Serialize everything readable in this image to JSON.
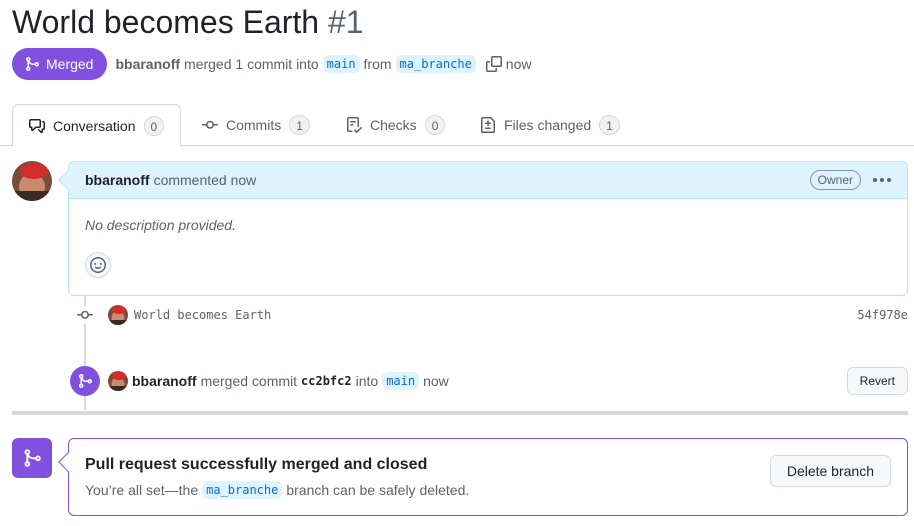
{
  "pr": {
    "title": "World becomes Earth",
    "number": "#1",
    "state_label": "Merged",
    "author": "bbaranoff",
    "merge_text": "merged 1 commit into",
    "base_branch": "main",
    "from_text": "from",
    "head_branch": "ma_branche",
    "time": "now"
  },
  "tabs": [
    {
      "label": "Conversation",
      "count": "0",
      "icon": "comment-discussion-icon"
    },
    {
      "label": "Commits",
      "count": "1",
      "icon": "git-commit-icon"
    },
    {
      "label": "Checks",
      "count": "0",
      "icon": "checklist-icon"
    },
    {
      "label": "Files changed",
      "count": "1",
      "icon": "file-diff-icon"
    }
  ],
  "comment": {
    "author": "bbaranoff",
    "action": "commented now",
    "role_label": "Owner",
    "body": "No description provided."
  },
  "commit": {
    "message": "World becomes Earth",
    "sha": "54f978e"
  },
  "merge_event": {
    "author": "bbaranoff",
    "text": "merged commit",
    "sha": "cc2bfc2",
    "into_text": "into",
    "branch": "main",
    "time": "now",
    "revert_label": "Revert"
  },
  "status": {
    "title": "Pull request successfully merged and closed",
    "desc_before": "You’re all set—the",
    "branch": "ma_branche",
    "desc_after": "branch can be safely deleted.",
    "delete_label": "Delete branch"
  },
  "colors": {
    "merged_purple": "#8250df",
    "link_blue": "#0969da",
    "branch_bg": "#ddf4ff"
  }
}
